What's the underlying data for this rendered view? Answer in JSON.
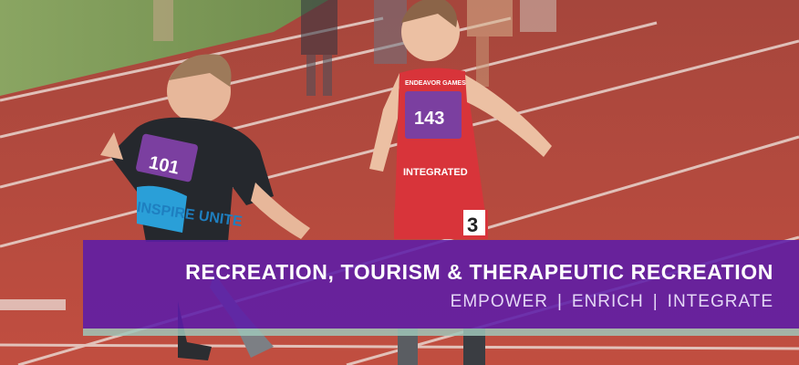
{
  "banner": {
    "title": "RECREATION, TOURISM & THERAPEUTIC RECREATION",
    "tag_1": "EMPOWER",
    "separator": "|",
    "tag_2": "ENRICH",
    "tag_3": "INTEGRATE"
  },
  "photo": {
    "bib_left": "101",
    "bib_right": "143",
    "shorts_number": "3",
    "shirt_text_left": "INSPIRE UNITE",
    "shirt_text_right": "INTEGRATED",
    "bib_header": "ENDEAVOR GAMES"
  },
  "colors": {
    "banner_purple": "#5c1ca8",
    "track_red": "#b2473b",
    "grass_green": "#7e9a55",
    "bib_purple": "#7b3fa0",
    "jersey_red": "#d8343a",
    "stripe_mint": "#9fc5b8"
  }
}
